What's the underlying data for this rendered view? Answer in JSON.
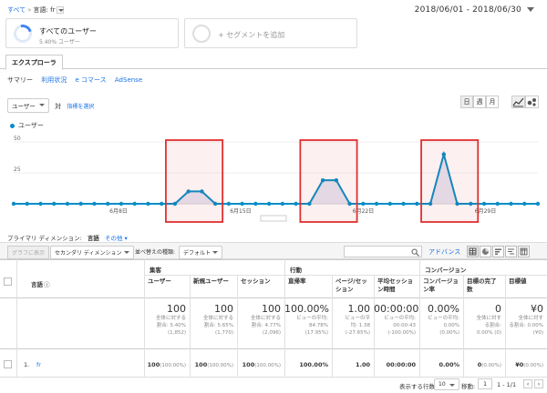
{
  "breadcrumb": {
    "root": "すべて",
    "current": "言語: fr"
  },
  "date_range": "2018/06/01 - 2018/06/30",
  "segments": {
    "all_users": {
      "title": "すべてのユーザー",
      "sub": "5.40% ユーザー"
    },
    "add": {
      "title": "+ セグメントを追加"
    }
  },
  "tabs": {
    "explorer": "エクスプローラ"
  },
  "subnav": [
    "サマリー",
    "利用状況",
    "e コマース",
    "AdSense"
  ],
  "metric": {
    "select": "ユーザー",
    "vs": "対",
    "choose": "指標を選択"
  },
  "granularity": [
    "日",
    "週",
    "月"
  ],
  "chart_data": {
    "type": "line",
    "series": [
      {
        "name": "ユーザー",
        "values": [
          0,
          0,
          0,
          0,
          0,
          0,
          0,
          0,
          0,
          0,
          0,
          0,
          0,
          10,
          10,
          0,
          0,
          0,
          0,
          0,
          0,
          0,
          0,
          19,
          19,
          0,
          0,
          0,
          0,
          0,
          0,
          0,
          40,
          0,
          0,
          0,
          0,
          0,
          0,
          0
        ]
      }
    ],
    "ylim": [
      0,
      50
    ],
    "yticks": [
      25,
      50
    ],
    "xticks": [
      "6月8日",
      "6月15日",
      "6月22日",
      "6月29日"
    ],
    "legend": "top-left",
    "color": "#058dc7",
    "highlight_color": "#e03030"
  },
  "dimension": {
    "label": "プライマリ ディメンション:",
    "value": "言語",
    "other": "その他 ▾"
  },
  "toolbar": {
    "graph_btn": "グラフに表示",
    "secondary": "セカンダリ ディメンション",
    "sort_label": "並べ替えの種類:",
    "sort_value": "デフォルト",
    "advanced": "アドバンス"
  },
  "table": {
    "groups": [
      "集客",
      "行動",
      "コンバージョン"
    ],
    "dim_header": "言語",
    "headers": [
      "ユーザー",
      "新規ユーザー",
      "セッション",
      "直帰率",
      "ページ/セッション",
      "平均セッション時間",
      "コンバージョン率",
      "目標の完了数",
      "目標値"
    ],
    "totals": [
      {
        "value": "100",
        "l1": "全体に対する",
        "l2": "割合: 5.40%",
        "l3": "(1,852)"
      },
      {
        "value": "100",
        "l1": "全体に対する",
        "l2": "割合: 5.65%",
        "l3": "(1,770)"
      },
      {
        "value": "100",
        "l1": "全体に対する",
        "l2": "割合: 4.77%",
        "l3": "(2,096)"
      },
      {
        "value": "100.00%",
        "l1": "ビューの平均:",
        "l2": "84.78%",
        "l3": "(17.95%)"
      },
      {
        "value": "1.00",
        "l1": "ビューの平",
        "l2": "均: 1.38",
        "l3": "(-27.65%)"
      },
      {
        "value": "00:00:00",
        "l1": "ビューの平均:",
        "l2": "00:00:43",
        "l3": "(-100.00%)"
      },
      {
        "value": "0.00%",
        "l1": "ビューの平均:",
        "l2": "0.00%",
        "l3": "(0.00%)"
      },
      {
        "value": "0",
        "l1": "全体に対す",
        "l2": "る割合:",
        "l3": "0.00% (0)"
      },
      {
        "value": "¥0",
        "l1": "全体に対す",
        "l2": "る割合: 0.00%",
        "l3": "(¥0)"
      }
    ],
    "row": {
      "index": "1.",
      "name": "fr",
      "values": [
        "100",
        "100",
        "100",
        "100.00%",
        "1.00",
        "00:00:00",
        "0.00%",
        "0",
        "¥0"
      ],
      "pcts": [
        "(100.00%)",
        "(100.00%)",
        "(100.00%)",
        "",
        "",
        "",
        "",
        "(0.00%)",
        "(0.00%)"
      ]
    }
  },
  "pagination": {
    "rows_label": "表示する行数:",
    "rows_value": "10",
    "goto_label": "移動:",
    "goto_value": "1",
    "range": "1 - 1/1"
  }
}
